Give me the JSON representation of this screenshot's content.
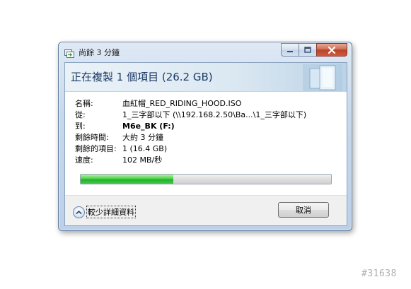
{
  "window": {
    "title": "尚餘 3 分鐘"
  },
  "header": {
    "title": "正在複製 1 個項目 (26.2 GB)"
  },
  "details": [
    {
      "label": "名稱:",
      "value": "血紅帽_RED_RIDING_HOOD.ISO",
      "bold": false
    },
    {
      "label": "從:",
      "value": "1_三字部以下 (\\\\192.168.2.50\\Ba...\\1_三字部以下)",
      "bold": false
    },
    {
      "label": "到:",
      "value": "M6e_BK (F:)",
      "bold": true
    },
    {
      "label": "剩餘時間:",
      "value": "大約 3 分鐘",
      "bold": false
    },
    {
      "label": "剩餘的項目:",
      "value": "1 (16.4 GB)",
      "bold": false
    },
    {
      "label": "速度:",
      "value": "102 MB/秒",
      "bold": false
    }
  ],
  "progress": {
    "percent": 37,
    "color": "#2cb52f"
  },
  "footer": {
    "toggle_label": "較少詳細資料",
    "cancel_label": "取消"
  },
  "watermark": "#31638",
  "icons": {
    "title": "copy-icon",
    "minimize": "minimize-icon",
    "maximize": "maximize-icon",
    "close": "close-icon",
    "toggle": "chevron-up-icon",
    "header_art": "copy-animation-icon"
  }
}
